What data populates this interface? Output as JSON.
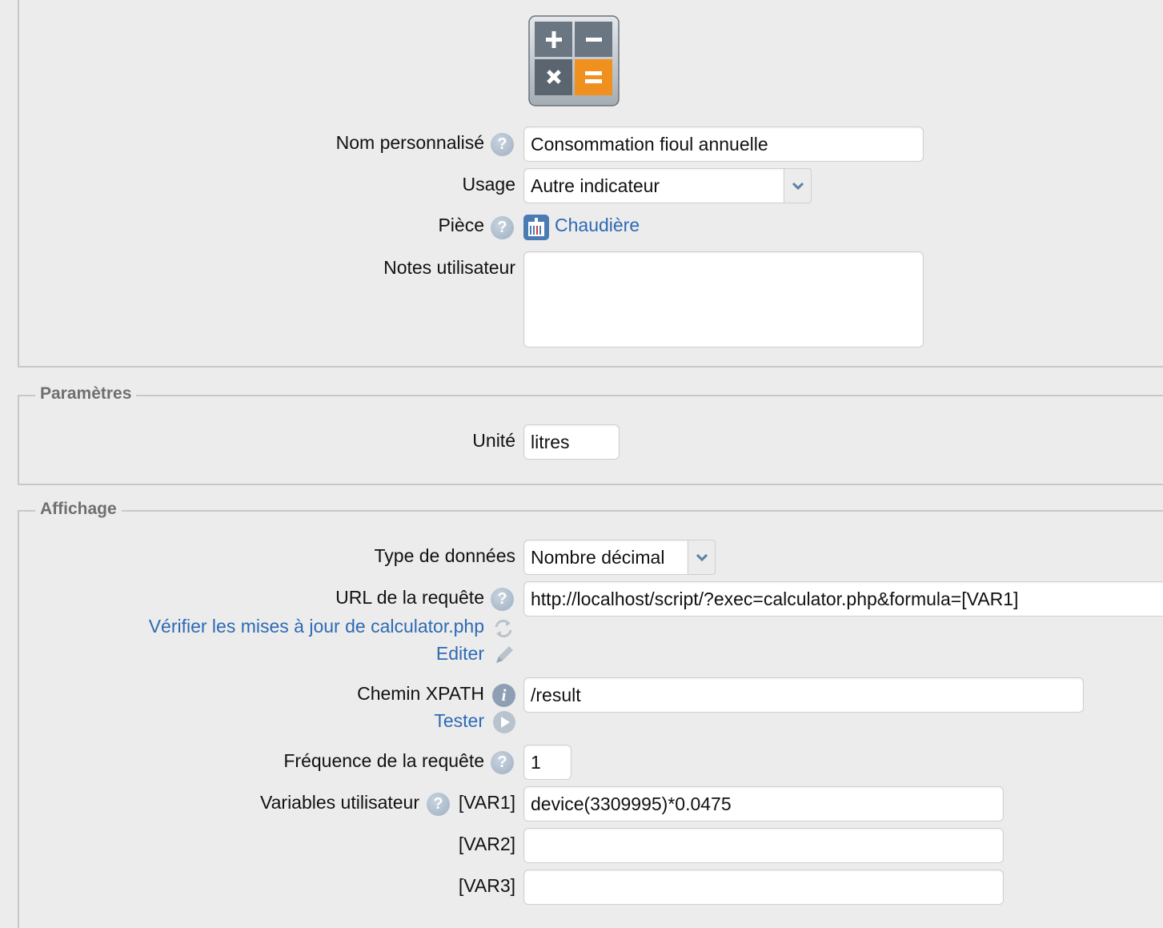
{
  "general": {
    "nom_label": "Nom personnalisé",
    "nom_value": "Consommation fioul annuelle",
    "usage_label": "Usage",
    "usage_value": "Autre indicateur",
    "piece_label": "Pièce",
    "piece_value": "Chaudière",
    "notes_label": "Notes utilisateur",
    "notes_value": ""
  },
  "parametres": {
    "legend": "Paramètres",
    "unite_label": "Unité",
    "unite_value": "litres"
  },
  "affichage": {
    "legend": "Affichage",
    "type_label": "Type de données",
    "type_value": "Nombre décimal",
    "url_label": "URL de la requête",
    "url_value": "http://localhost/script/?exec=calculator.php&formula=[VAR1]",
    "check_updates_link": "Vérifier les mises à jour de calculator.php",
    "edit_link": "Editer",
    "xpath_label": "Chemin XPATH",
    "xpath_value": "/result",
    "test_link": "Tester",
    "freq_label": "Fréquence de la requête",
    "freq_value": "1",
    "vars_label": "Variables utilisateur",
    "var1_label": "[VAR1]",
    "var1_value": "device(3309995)*0.0475",
    "var2_label": "[VAR2]",
    "var2_value": "",
    "var3_label": "[VAR3]",
    "var3_value": ""
  },
  "icons": {
    "help": "?",
    "info": "i"
  },
  "colors": {
    "link": "#2d6ab5",
    "calc_orange": "#f0901f",
    "calc_gray": "#5f6b77"
  }
}
